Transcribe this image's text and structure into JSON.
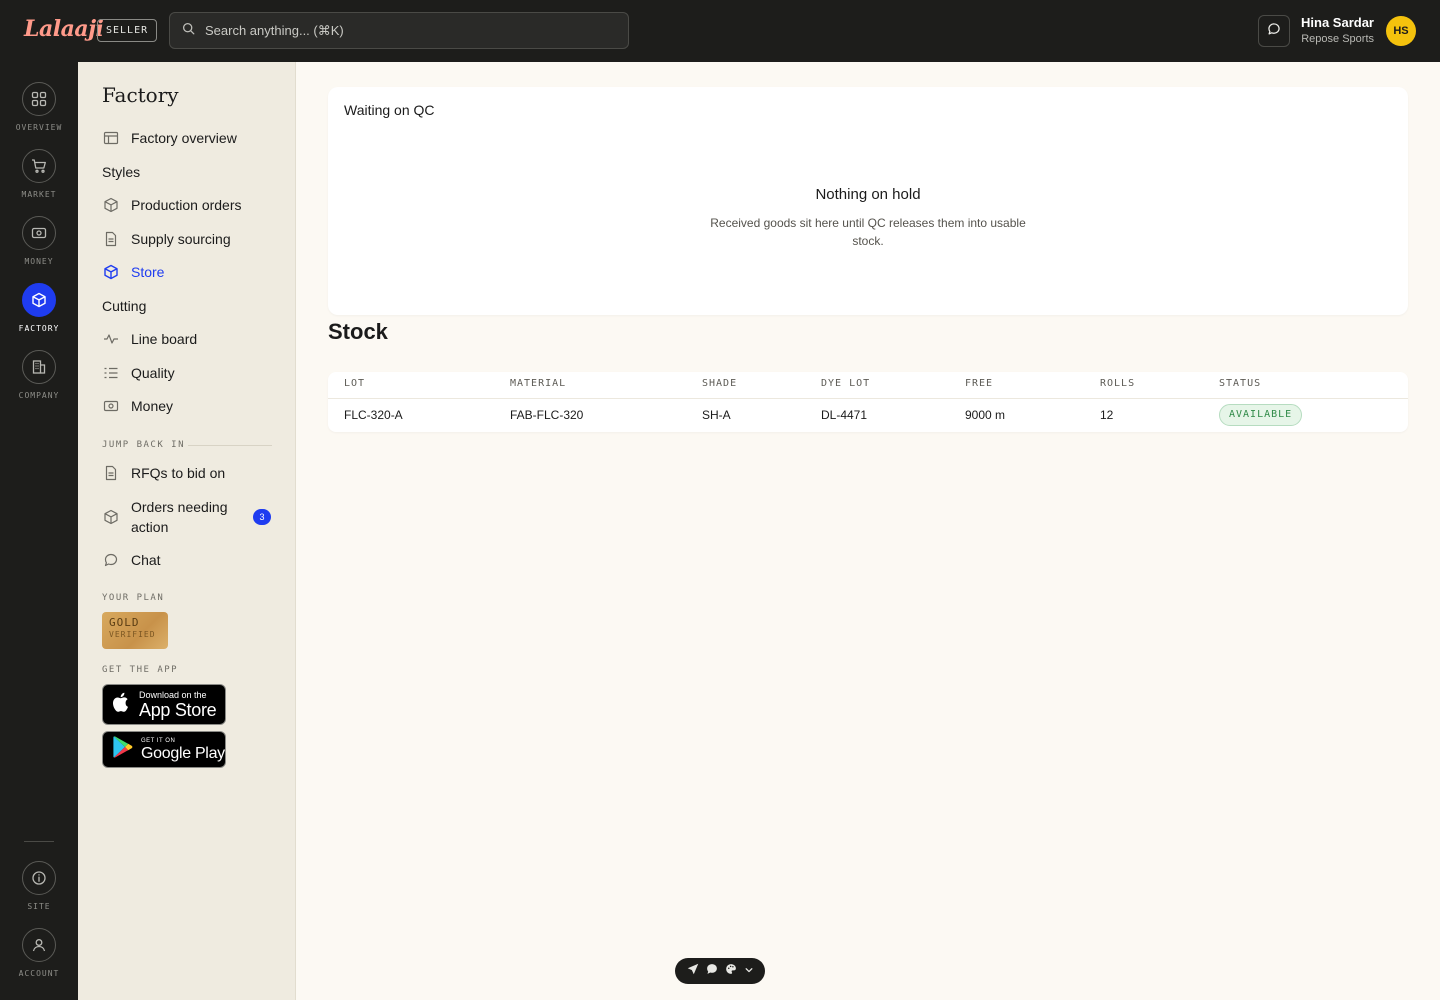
{
  "header": {
    "logo": "Lalaaji",
    "seller_badge": "SELLER",
    "search_placeholder": "Search anything... (⌘K)",
    "user_name": "Hina Sardar",
    "user_company": "Repose Sports",
    "avatar_initials": "HS"
  },
  "rail": {
    "items": [
      {
        "label": "OVERVIEW",
        "icon": "grid-icon"
      },
      {
        "label": "MARKET",
        "icon": "cart-icon"
      },
      {
        "label": "MONEY",
        "icon": "banknote-icon"
      },
      {
        "label": "FACTORY",
        "icon": "box-icon",
        "active": true
      },
      {
        "label": "COMPANY",
        "icon": "building-icon"
      }
    ],
    "bottom": [
      {
        "label": "SITE",
        "icon": "info-icon"
      },
      {
        "label": "ACCOUNT",
        "icon": "user-icon"
      }
    ]
  },
  "sidenav": {
    "title": "Factory",
    "overview": "Factory overview",
    "styles_head": "Styles",
    "production_orders": "Production orders",
    "supply_sourcing": "Supply sourcing",
    "store": "Store",
    "cutting_head": "Cutting",
    "line_board": "Line board",
    "quality": "Quality",
    "money": "Money",
    "jump_back_in": "JUMP BACK IN",
    "rfqs": "RFQs to bid on",
    "orders_needing_action_1": "Orders needing",
    "orders_needing_action_2": "action",
    "orders_count": "3",
    "chat": "Chat",
    "your_plan": "YOUR PLAN",
    "plan_tier": "GOLD",
    "plan_note": "VERIFIED",
    "get_the_app": "GET THE APP",
    "app_store_small": "Download on the",
    "app_store_big": "App Store",
    "google_small": "GET IT ON",
    "google_big": "Google Play"
  },
  "main": {
    "qc_title": "Waiting on QC",
    "empty_title": "Nothing on hold",
    "empty_desc": "Received goods sit here until QC releases them into usable stock.",
    "stock_title": "Stock",
    "columns": [
      "LOT",
      "MATERIAL",
      "SHADE",
      "DYE LOT",
      "FREE",
      "ROLLS",
      "STATUS"
    ],
    "rows": [
      {
        "lot": "FLC-320-A",
        "material": "FAB-FLC-320",
        "shade": "SH-A",
        "dye_lot": "DL-4471",
        "free": "9000 m",
        "rolls": "12",
        "status": "AVAILABLE"
      }
    ]
  },
  "colors": {
    "accent": "#1f3cf0",
    "dark": "#1d1d1b",
    "sidebar": "#efebe0",
    "status_ok": "#2f8a47"
  }
}
